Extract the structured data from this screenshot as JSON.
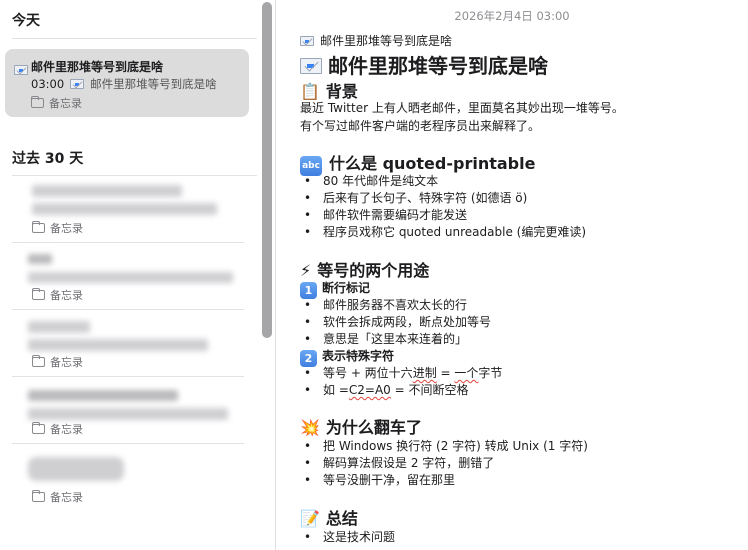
{
  "sidebar": {
    "sections": {
      "today": "今天",
      "past30": "过去 30 天"
    },
    "selected_note": {
      "title": "邮件里那堆等号到底是啥",
      "time": "03:00",
      "preview": "邮件里那堆等号到底是啥",
      "folder": "备忘录"
    },
    "notes": [
      {
        "folder": "备忘录"
      },
      {
        "folder": "备忘录"
      },
      {
        "folder": "备忘录"
      },
      {
        "folder": "备忘录"
      },
      {
        "folder": "备忘录"
      }
    ]
  },
  "editor": {
    "date": "2026年2月4日 03:00",
    "subtitle": "邮件里那堆等号到底是啥",
    "title": "邮件里那堆等号到底是啥",
    "sections": [
      {
        "emoji": "📋",
        "heading": "背景",
        "paragraphs": [
          "最近 Twitter 上有人晒老邮件，里面莫名其妙出现一堆等号。",
          "有个写过邮件客户端的老程序员出来解释了。"
        ]
      },
      {
        "badge": "abc",
        "heading": "什么是 quoted-printable",
        "bullets": [
          "80 年代邮件是纯文本",
          "后来有了长句子、特殊字符 (如德语 ö)",
          "邮件软件需要编码才能发送",
          "程序员戏称它 quoted unreadable (编完更难读)"
        ]
      },
      {
        "emoji": "⚡",
        "heading": "等号的两个用途",
        "subsections": [
          {
            "badge": "1",
            "heading": "断行标记",
            "bullets": [
              "邮件服务器不喜欢太长的行",
              "软件会拆成两段，断点处加等号",
              "意思是「这里本来连着的」"
            ]
          },
          {
            "badge": "2",
            "heading": "表示特殊字符",
            "bullets": [
              "等号 + 两位十六进制 = 一个字节",
              "如 =C2=A0 = 不间断空格"
            ]
          }
        ]
      },
      {
        "emoji": "💥",
        "heading": "为什么翻车了",
        "bullets": [
          "把 Windows 换行符 (2 字符) 转成 Unix (1 字符)",
          "解码算法假设是 2 字符，删错了",
          "等号没删干净，留在那里"
        ]
      },
      {
        "emoji": "📝",
        "heading": "总结",
        "bullets": [
          "这是技术问题"
        ]
      }
    ]
  },
  "colors": {
    "selection_bg": "#dcdcdc",
    "scrollbar": "#a6a6a8",
    "misspell_underline": "#e0463a",
    "badge_blue": "#3f7fe0"
  }
}
